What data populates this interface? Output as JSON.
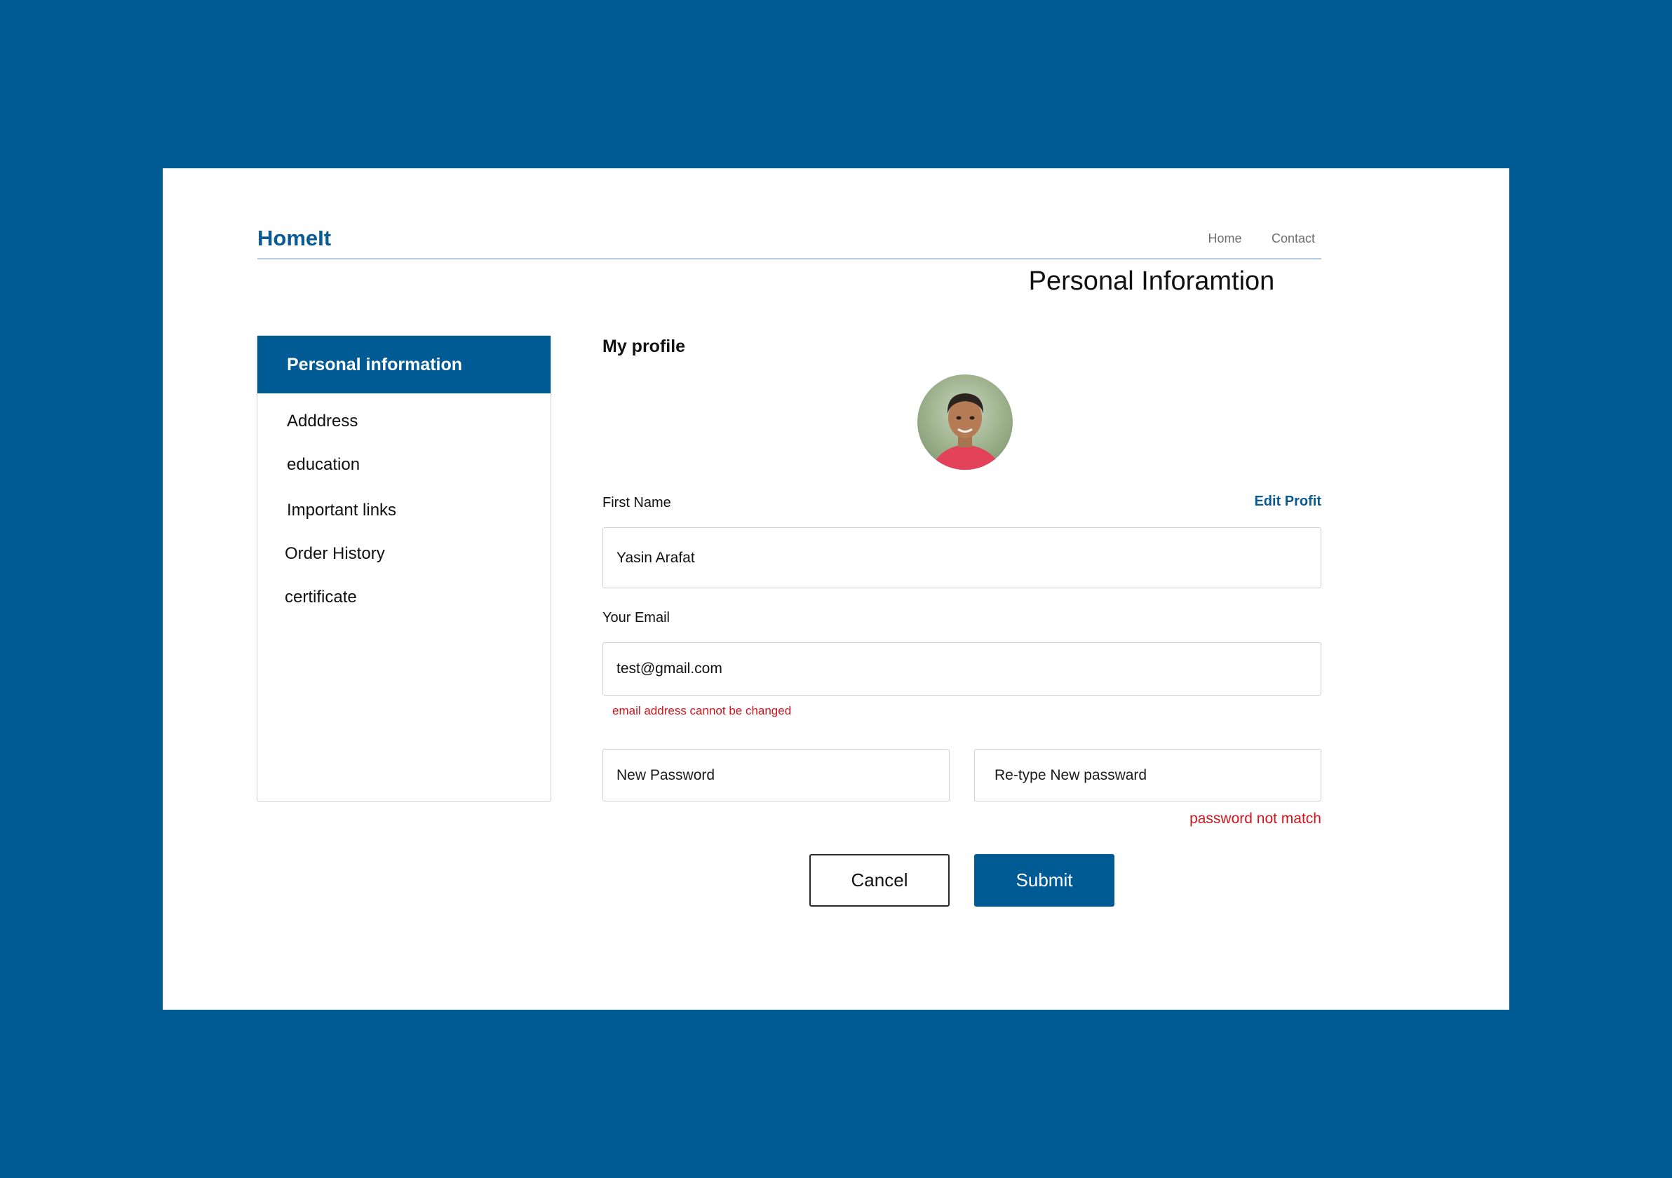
{
  "app": {
    "brand": "HomeIt"
  },
  "nav": {
    "links": [
      "Home",
      "Contact"
    ]
  },
  "page": {
    "title": "Personal Inforamtion"
  },
  "sidebar": {
    "active": "Personal information",
    "items": [
      "Adddress",
      "education",
      "Important links",
      "Order History",
      "certificate"
    ]
  },
  "profile": {
    "section_label": "My profile",
    "edit_label": "Edit Profit",
    "first_name_label": "First Name",
    "first_name_value": "Yasin Arafat",
    "email_label": "Your Email",
    "email_value": "test@gmail.com",
    "email_error": "email address cannot be changed",
    "new_password_placeholder": "New Password",
    "retype_password_placeholder": "Re-type New passward",
    "password_error": "password not match"
  },
  "actions": {
    "cancel": "Cancel",
    "submit": "Submit"
  },
  "colors": {
    "brand": "#005a94",
    "error": "#d0141c",
    "border": "#cfcfcf"
  }
}
